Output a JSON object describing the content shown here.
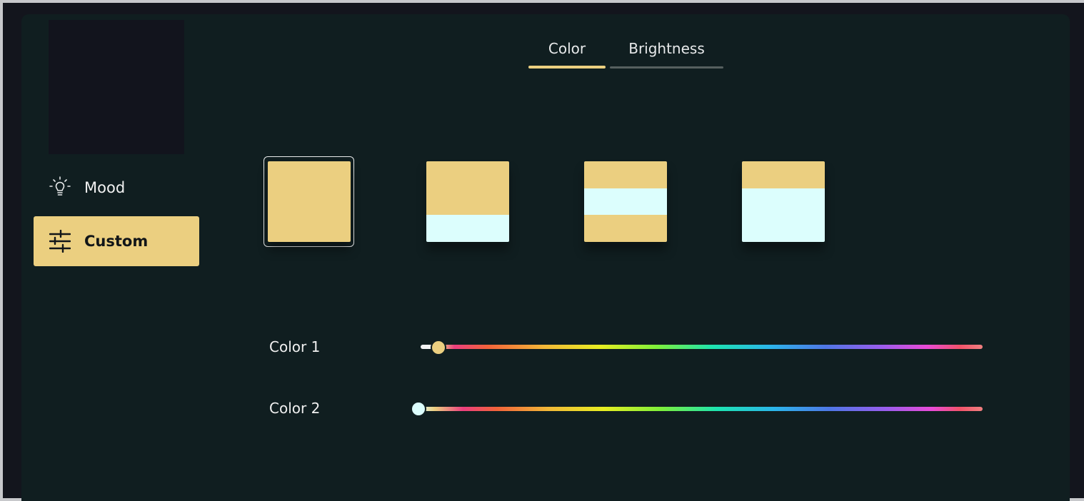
{
  "colors": {
    "accent": "#ebcf80",
    "secondary": "#dcfefd",
    "panel": "#101e20"
  },
  "sidebar": {
    "items": [
      {
        "label": "Mood",
        "icon": "lightbulb-icon",
        "active": false
      },
      {
        "label": "Custom",
        "icon": "sliders-icon",
        "active": true
      }
    ]
  },
  "tabs": [
    {
      "label": "Color",
      "active": true
    },
    {
      "label": "Brightness",
      "active": false
    }
  ],
  "patterns": [
    {
      "name": "solid",
      "bands": [
        "#ebcf80",
        "#ebcf80",
        "#ebcf80"
      ],
      "selected": true
    },
    {
      "name": "top-heavy",
      "bands": [
        "#ebcf80",
        "#ebcf80",
        "#dcfefd"
      ],
      "selected": false
    },
    {
      "name": "sandwich",
      "bands": [
        "#ebcf80",
        "#dcfefd",
        "#ebcf80"
      ],
      "selected": false
    },
    {
      "name": "bottom-heavy",
      "bands": [
        "#ebcf80",
        "#dcfefd",
        "#dcfefd"
      ],
      "selected": false
    }
  ],
  "sliders": [
    {
      "label": "Color 1",
      "value": 0.03,
      "color": "#ebcf80"
    },
    {
      "label": "Color 2",
      "value": 0.0,
      "color": "#dcfefd"
    }
  ]
}
